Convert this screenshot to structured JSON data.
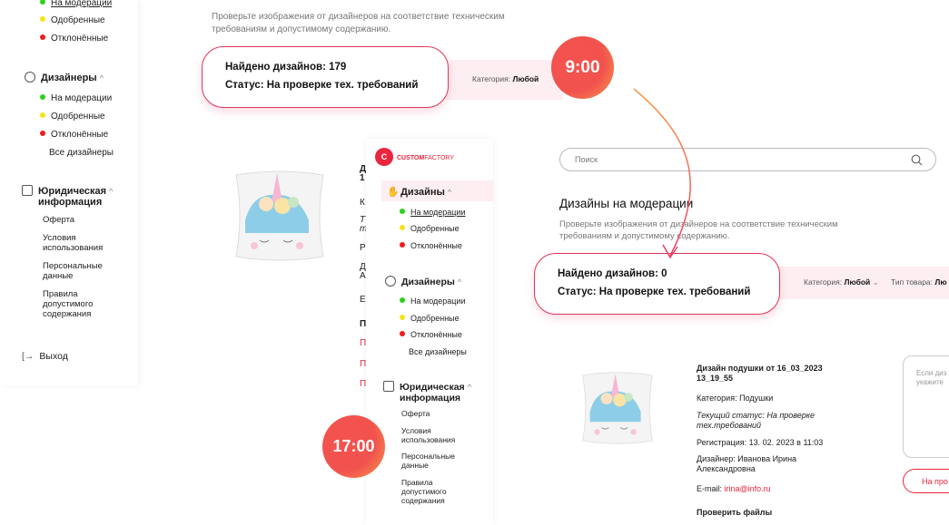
{
  "back": {
    "sidebar": {
      "moderation_top": "На модерации",
      "approved_top": "Одобренные",
      "rejected_top": "Отклонённые",
      "designers_label": "Дизайнеры",
      "designers_items": [
        "На модерации",
        "Одобренные",
        "Отклонённые"
      ],
      "all_designers": "Все дизайнеры",
      "legal_label_1": "Юридическая",
      "legal_label_2": "информация",
      "legal_items": [
        "Оферта",
        "Условия использования",
        "Персональные данные",
        "Правила допустимого содержания"
      ],
      "logout": "Выход"
    },
    "description": "Проверьте изображения от дизайнеров на соответствие техническим требованиям и допустимому содержанию.",
    "found": "Найдено дизайнов: 179",
    "status": "Статус: На проверке тех. требований",
    "category_label": "Категория:",
    "category_value": "Любой"
  },
  "badges": {
    "morning": "9:00",
    "evening": "17:00"
  },
  "front": {
    "brand": "CUSTOMFACTORY",
    "brand_bold": "CUSTOM",
    "brand_rest": "FACTORY",
    "logo_letter": "C",
    "sidebar": {
      "designs_label": "Дизайны",
      "design_items": [
        "На модерации",
        "Одобренные",
        "Отклонённые"
      ],
      "designers_label": "Дизайнеры",
      "designer_items": [
        "На модерации",
        "Одобренные",
        "Отклонённые"
      ],
      "all_designers": "Все дизайнеры",
      "legal_label_1": "Юридическая",
      "legal_label_2": "информация",
      "legal_items": [
        "Оферта",
        "Условия использования",
        "Персональные данные",
        "Правила допустимого содержания"
      ]
    },
    "search_placeholder": "Поиск",
    "title": "Дизайны на модерации",
    "description": "Проверьте изображения от дизайнеров на соответствие техническим требованиям и допустимому содержанию.",
    "found": "Найдено дизайнов: 0",
    "status": "Статус: На проверке тех. требований",
    "category_label": "Категория:",
    "category_value": "Любой",
    "product_type_label": "Тип товара:",
    "product_type_value": "Лю",
    "card": {
      "title": "Дизайн подушки от 16_03_2023 13_19_55",
      "category": "Категория: Подушки",
      "status": "Текущий статус: На проверке тех.требований",
      "registration": "Регистрация: 13. 02. 2023 в 11:03",
      "designer": "Дизайнер: Иванова Ирина Александровна",
      "email_label": "E-mail:",
      "email": "irina@info.ru",
      "check_files": "Проверить файлы",
      "comment_placeholder": "Если диз укажите",
      "action_button": "На про"
    }
  }
}
